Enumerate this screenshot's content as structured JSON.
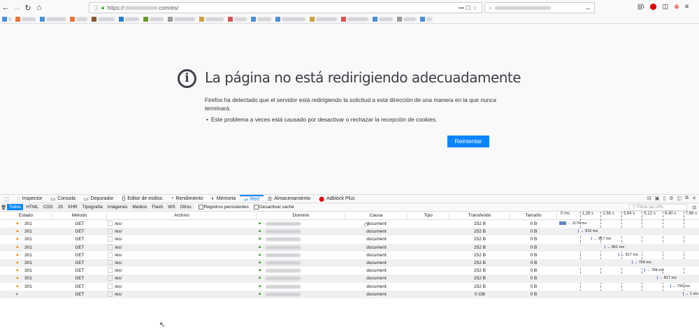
{
  "browser": {
    "url_prefix": "https://",
    "url_suffix": "com/es/",
    "menu_icons": [
      "back-icon",
      "forward-icon",
      "reload-icon",
      "home-icon"
    ]
  },
  "error_page": {
    "title": "La página no está redirigiendo adecuadamente",
    "description": "Firefox ha detectado que el servidor está redirigiendo la solicitud a esta dirección de una manera en la que nunca terminará.",
    "bullet": "Este problema a veces está causado por desactivar o rechazar la recepción de cookies.",
    "retry_label": "Reintentar"
  },
  "devtools": {
    "tabs": [
      "Inspector",
      "Consola",
      "Depurador",
      "Editor de estilos",
      "Rendimiento",
      "Memoria",
      "Red",
      "Almacenamiento",
      "Adblock Plus"
    ],
    "active_tab": "Red",
    "filters": [
      "Todos",
      "HTML",
      "CSS",
      "JS",
      "XHR",
      "Tipografía",
      "Imágenes",
      "Medios",
      "Flash",
      "WS",
      "Otros"
    ],
    "active_filter": "Todos",
    "persist_label": "Registros persistentes",
    "cache_label": "Desactivar caché",
    "filter_placeholder": "Filtrar las URL",
    "columns": [
      "Estado",
      "Método",
      "Archivo",
      "Dominio",
      "Causa",
      "Tipo",
      "Transferido",
      "Tamaño"
    ],
    "timeline_ticks": [
      "0 ms",
      "1,28 s",
      "2,56 s",
      "3,84 s",
      "5,12 s",
      "6,40 s",
      "7,68 s"
    ],
    "requests": [
      {
        "status": "301",
        "method": "GET",
        "file": "/es/",
        "cause": "document",
        "transferred": "252 B",
        "size": "0 B",
        "time": "→ 1170 ms",
        "ms": 1170
      },
      {
        "status": "301",
        "method": "GET",
        "file": "/es/",
        "cause": "document",
        "transferred": "252 B",
        "size": "0 B",
        "time": "→ 816 ms",
        "ms": 816
      },
      {
        "status": "301",
        "method": "GET",
        "file": "/es/",
        "cause": "document",
        "transferred": "252 B",
        "size": "0 B",
        "time": "→ 817 ms",
        "ms": 817
      },
      {
        "status": "301",
        "method": "GET",
        "file": "/es/",
        "cause": "document",
        "transferred": "252 B",
        "size": "0 B",
        "time": "→ 851 ms",
        "ms": 851
      },
      {
        "status": "301",
        "method": "GET",
        "file": "/es/",
        "cause": "document",
        "transferred": "252 B",
        "size": "0 B",
        "time": "→ 817 ms",
        "ms": 817
      },
      {
        "status": "301",
        "method": "GET",
        "file": "/es/",
        "cause": "document",
        "transferred": "252 B",
        "size": "0 B",
        "time": "→ 769 ms",
        "ms": 769
      },
      {
        "status": "301",
        "method": "GET",
        "file": "/es/",
        "cause": "document",
        "transferred": "252 B",
        "size": "0 B",
        "time": "→ 784 ms",
        "ms": 784
      },
      {
        "status": "301",
        "method": "GET",
        "file": "/es/",
        "cause": "document",
        "transferred": "252 B",
        "size": "0 B",
        "time": "→ 817 ms",
        "ms": 817
      },
      {
        "status": "301",
        "method": "GET",
        "file": "/es/",
        "cause": "document",
        "transferred": "252 B",
        "size": "0 B",
        "time": "→ 790 ms",
        "ms": 790
      },
      {
        "status": "",
        "method": "GET",
        "file": "/es/",
        "cause": "document",
        "transferred": "0 GB",
        "size": "0 B",
        "time": "→ 1 ms",
        "ms": 1
      }
    ]
  },
  "colors": {
    "accent": "#0a84ff",
    "warning": "#e5850b",
    "bar": "#5f88c4"
  }
}
